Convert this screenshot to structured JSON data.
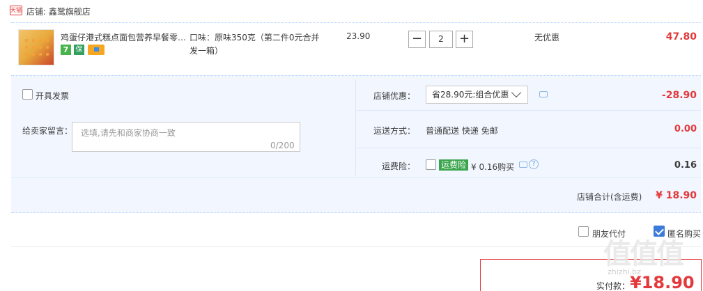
{
  "shop": {
    "badge": "天猫",
    "label": "店铺: 鑫鹭旗舰店"
  },
  "item": {
    "title": "鸡蛋仔港式糕点面包营养早餐零…",
    "badge_seven": "7",
    "badge_shield": "保",
    "sku": "口味：原味350克（第二件0元合并发一箱）",
    "price": "23.90",
    "quantity": "2",
    "minus_label": "−",
    "plus_label": "+",
    "discount": "无优惠",
    "subtotal": "47.80"
  },
  "options": {
    "invoice_label": "开具发票",
    "message_label": "给卖家留言：",
    "message_placeholder": "选填,请先和商家协商一致",
    "message_count": "0/200",
    "shop_discount_label": "店铺优惠：",
    "shop_discount_value": "省28.90元:组合优惠",
    "shop_discount_amount": "-28.90",
    "shipping_label": "运送方式：",
    "shipping_value": "普通配送 快递 免邮",
    "shipping_amount": "0.00",
    "insurance_label": "运费险：",
    "insurance_tag": "运费险",
    "insurance_price": "¥ 0.16购买",
    "insurance_amount": "0.16",
    "help_glyph": "?",
    "total_label": "店铺合计(含运费)",
    "total_amount": "¥ 18.90"
  },
  "bottom": {
    "friend_pay_label": "朋友代付",
    "anonymous_label": "匿名购买",
    "anonymous_checked": true,
    "pay_label": "实付款：",
    "pay_amount": "¥18.90"
  },
  "watermark": {
    "text": "值值值",
    "sub": "zhizhi.bz"
  },
  "colors": {
    "accent_red": "#e4393c",
    "panel_bg": "#f2f7ff",
    "checkbox_blue": "#3d7bd8",
    "insurance_green": "#3aa54c"
  }
}
